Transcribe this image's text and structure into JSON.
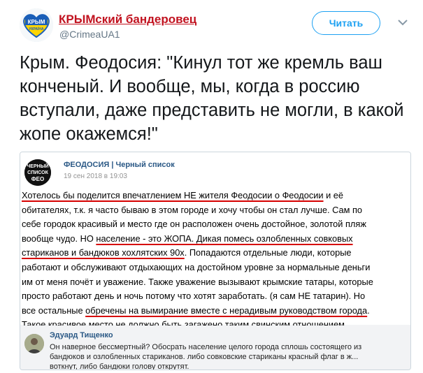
{
  "tweet": {
    "author_name": "КРЫМский бандеровец",
    "handle": "@CrimeaUA1",
    "follow_label": "Читать",
    "text": "Крым. Феодосия: \"Кинул тот же кремль ваш конченый. И вообще, мы, когда в россию вступали, даже представить не могли, в какой жопе окажемся!\""
  },
  "avatar": {
    "line1": "КРЫМ",
    "line2": "УКРАЇНА"
  },
  "embed": {
    "group_logo": {
      "line1": "ЧЕРНЫЙ",
      "line2": "СПИСОК",
      "line3": "ФЕО"
    },
    "group_name": "ФЕОДОСИЯ | Черный список",
    "date": "19 сен 2018 в 19:03",
    "lines": [
      {
        "a": "Хотелось бы поделится впечатлением НЕ жителя Феодосии о Феодосии",
        "b": " и её"
      },
      {
        "a": "обитателях, т.к. я часто бываю в этом городе и хочу чтобы он стал лучше. Сам по"
      },
      {
        "a": "себе городок красивый и место где он расположен очень достойное, золотой пляж"
      },
      {
        "a": "вообще чудо. НО ",
        "b": "население - это ЖОПА. Дикая помесь озлобленных совковых"
      },
      {
        "a": "стариканов и бандюков хохлятских 90х",
        "b": ". Попадаются отдельные люди, которые"
      },
      {
        "a": "работают и обслуживают отдыхающих на достойном уровне за нормальные деньги"
      },
      {
        "a": "им от меня почёт и уважение. Также уважение вызывают крымские татары, которые"
      },
      {
        "a": "просто работают день и ночь потому что хотят заработать. (я сам НЕ татарин). Но"
      },
      {
        "a": "все остальные ",
        "b": "обречены на вымирание вместе с нерадивым руководством города",
        "c": "."
      },
      {
        "a": "Такое красивое место не должно быть загажено таким свинским отношением."
      }
    ],
    "comment": {
      "author": "Эдуард Тищенко",
      "line1": "Он наверное бессмертный? Обосрать население целого города сплошь состоящего из",
      "line2": "бандюков и озлобленных стариканов. либо совковские стариканы красный флаг в ж...",
      "line3": "воткнут, либо бандюки голову открутят."
    }
  },
  "colors": {
    "author_name": "#c1121f",
    "follow_accent": "#1da1f2",
    "underline": "#d60000",
    "vk_link": "#2a5885"
  }
}
